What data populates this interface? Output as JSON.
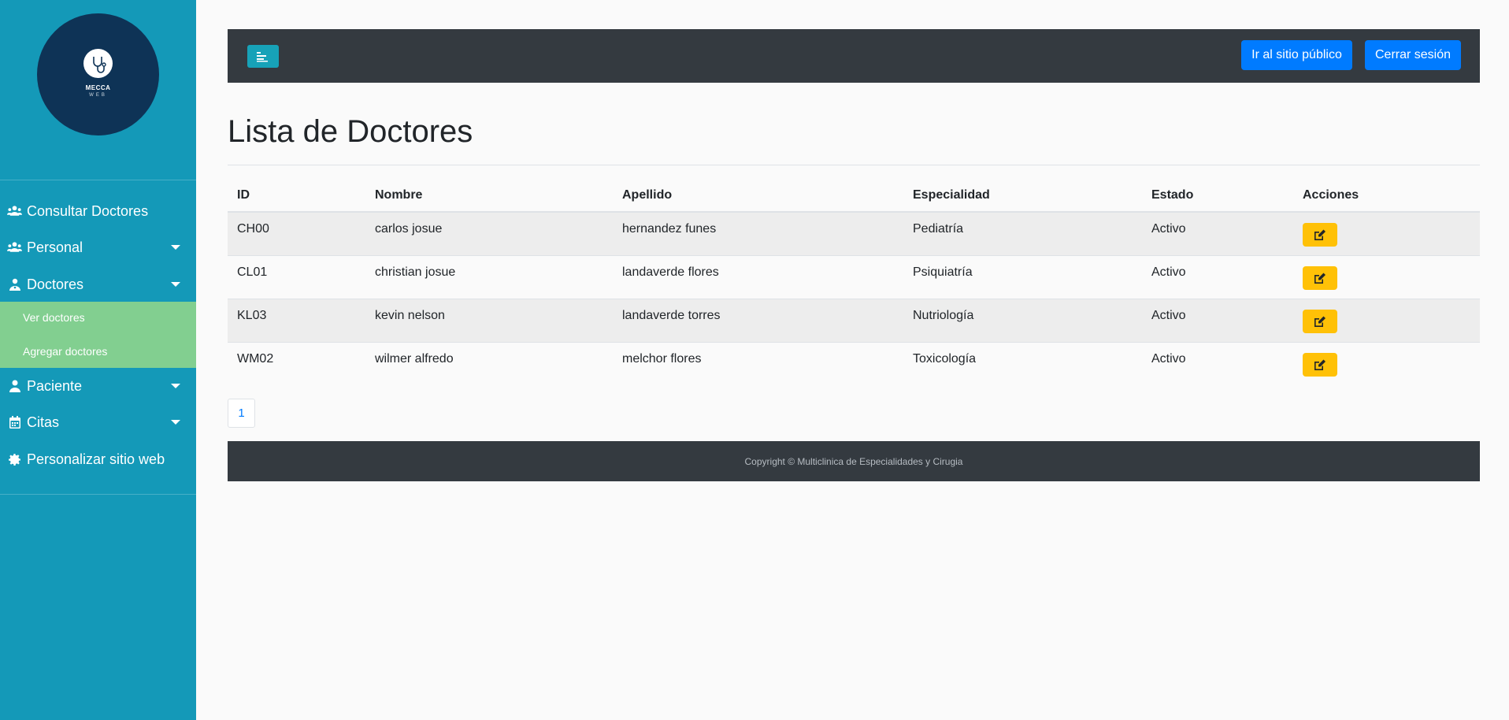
{
  "brand": {
    "name": "MECCA",
    "sub": "WEB"
  },
  "sidebar": {
    "items": [
      {
        "label": "Consultar Doctores",
        "icon": "users-icon"
      },
      {
        "label": "Personal",
        "icon": "users-icon"
      },
      {
        "label": "Doctores",
        "icon": "doctor-icon"
      },
      {
        "label": "Paciente",
        "icon": "user-icon"
      },
      {
        "label": "Citas",
        "icon": "calendar-icon"
      },
      {
        "label": "Personalizar sitio web",
        "icon": "gear-icon"
      }
    ],
    "submenu": [
      {
        "label": "Ver doctores"
      },
      {
        "label": "Agregar doctores"
      }
    ]
  },
  "topbar": {
    "public_site_label": "Ir al sitio público",
    "logout_label": "Cerrar sesión"
  },
  "page": {
    "title": "Lista de Doctores"
  },
  "table": {
    "columns": [
      "ID",
      "Nombre",
      "Apellido",
      "Especialidad",
      "Estado",
      "Acciones"
    ],
    "rows": [
      [
        "CH00",
        "carlos josue",
        "hernandez funes",
        "Pediatría",
        "Activo"
      ],
      [
        "CL01",
        "christian josue",
        "landaverde flores",
        "Psiquiatría",
        "Activo"
      ],
      [
        "KL03",
        "kevin nelson",
        "landaverde torres",
        "Nutriología",
        "Activo"
      ],
      [
        "WM02",
        "wilmer alfredo",
        "melchor flores",
        "Toxicología",
        "Activo"
      ]
    ]
  },
  "pagination": {
    "current": "1"
  },
  "footer": {
    "text": "Copyright © Multiclinica de Especialidades y Cirugia"
  },
  "colors": {
    "sidebar": "#1499b8",
    "submenu": "#82cf90",
    "navbar": "#343a40",
    "primary": "#007bff",
    "warning": "#ffc107",
    "info": "#17a2b8"
  }
}
